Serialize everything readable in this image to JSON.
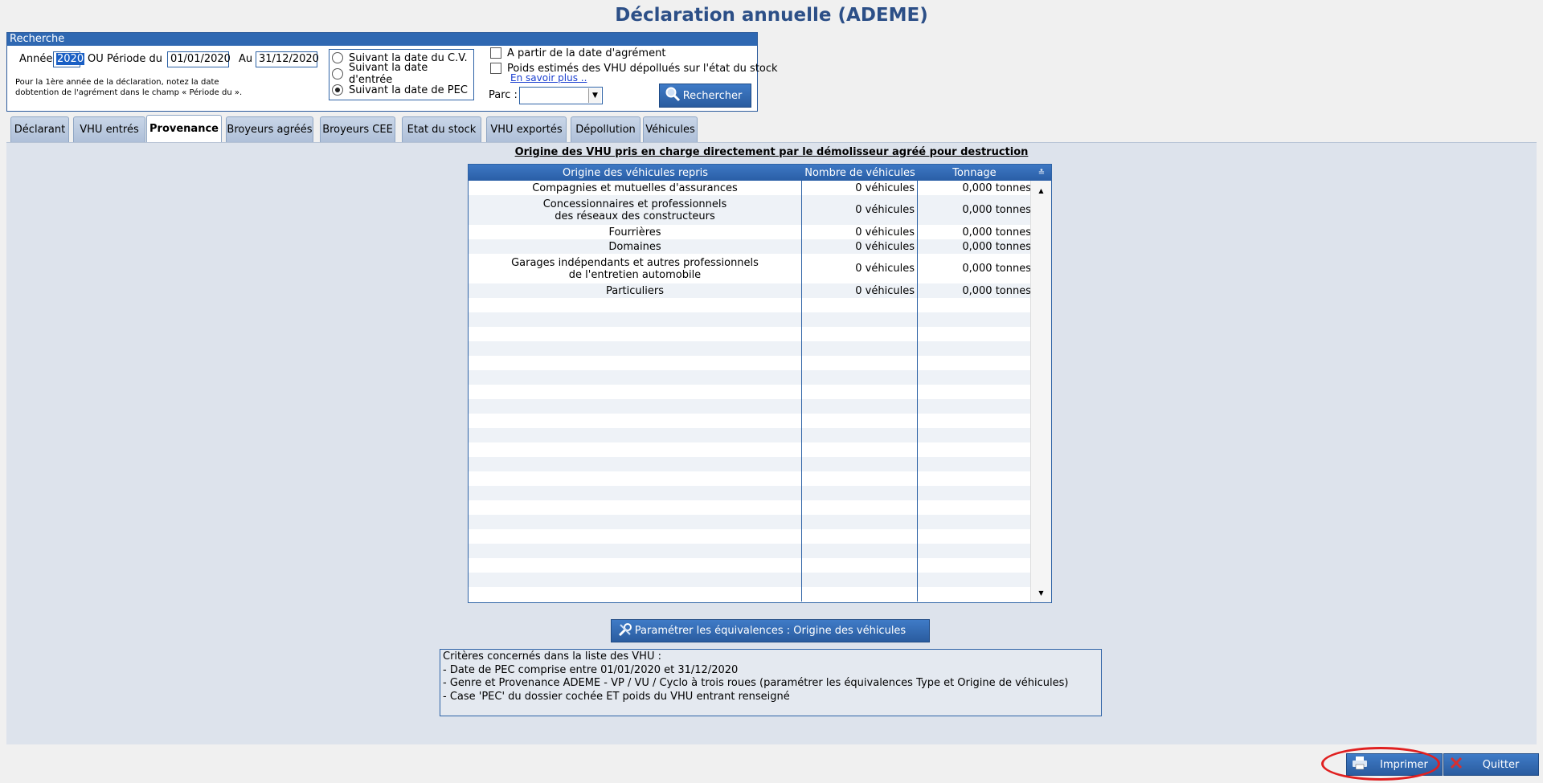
{
  "page_title": "Déclaration annuelle (ADEME)",
  "search": {
    "header": "Recherche",
    "year_label": "Année",
    "year_value": "2020",
    "period_label": "OU Période du",
    "period_from": "01/01/2020",
    "period_to_label": "Au",
    "period_to": "31/12/2020",
    "note_line1": "Pour la 1ère année de la déclaration, notez la date",
    "note_line2": "dobtention de l'agrément dans le champ « Période du ».",
    "radios": [
      {
        "label": "Suivant la date du C.V.",
        "selected": false
      },
      {
        "label": "Suivant la date d'entrée",
        "selected": false
      },
      {
        "label": "Suivant la date de PEC",
        "selected": true
      }
    ],
    "check_agrement": "A partir de la date d'agrément",
    "check_poids": "Poids estimés des VHU dépollués sur l'état du stock",
    "learn_more": "En savoir plus ..",
    "parc_label": "Parc :",
    "parc_value": "",
    "search_button": "Rechercher"
  },
  "tabs": [
    {
      "label": "Déclarant",
      "active": false
    },
    {
      "label": "VHU entrés",
      "active": false
    },
    {
      "label": "Provenance",
      "active": true
    },
    {
      "label": "Broyeurs agréés",
      "active": false
    },
    {
      "label": "Broyeurs CEE",
      "active": false
    },
    {
      "label": "Etat du stock",
      "active": false
    },
    {
      "label": "VHU exportés",
      "active": false
    },
    {
      "label": "Dépollution",
      "active": false
    },
    {
      "label": "Véhicules",
      "active": false
    }
  ],
  "section_title": "Origine des VHU pris en charge directement par le démolisseur agréé pour destruction",
  "table": {
    "headers": [
      "Origine des véhicules repris",
      "Nombre de véhicules",
      "Tonnage"
    ],
    "rows": [
      {
        "origin": "Compagnies et mutuelles d'assurances",
        "count": "0 véhicules",
        "tonnage": "0,000 tonnes"
      },
      {
        "origin": "Concessionnaires et professionnels\ndes réseaux des constructeurs",
        "count": "0 véhicules",
        "tonnage": "0,000 tonnes"
      },
      {
        "origin": "Fourrières",
        "count": "0 véhicules",
        "tonnage": "0,000 tonnes"
      },
      {
        "origin": "Domaines",
        "count": "0 véhicules",
        "tonnage": "0,000 tonnes"
      },
      {
        "origin": "Garages indépendants et autres professionnels\nde l'entretien automobile",
        "count": "0 véhicules",
        "tonnage": "0,000 tonnes"
      },
      {
        "origin": "Particuliers",
        "count": "0 véhicules",
        "tonnage": "0,000 tonnes"
      }
    ]
  },
  "param_button": "Paramétrer les équivalences : Origine des véhicules",
  "criteria": [
    "Critères concernés dans la liste des VHU :",
    "- Date de PEC comprise entre 01/01/2020 et 31/12/2020",
    "- Genre et Provenance ADEME - VP / VU / Cyclo à trois roues (paramétrer les équivalences Type et Origine de véhicules)",
    "- Case 'PEC' du dossier cochée ET poids du VHU entrant renseigné"
  ],
  "footer": {
    "print_button": "Imprimer",
    "quit_button": "Quitter"
  },
  "colors": {
    "title": "#2c4f87",
    "accent": "#2f68b2",
    "highlight": "#e02020"
  }
}
